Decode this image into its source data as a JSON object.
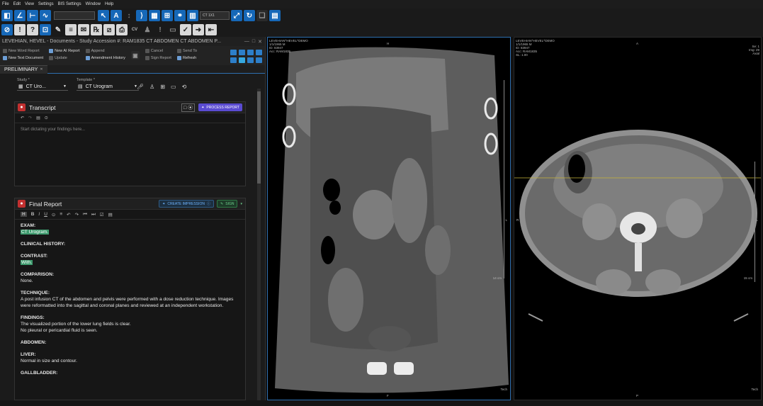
{
  "menu": [
    "File",
    "Edit",
    "View",
    "Settings",
    "BIS Settings",
    "Window",
    "Help"
  ],
  "toolbar": {
    "layout_combo": "CT 1X1"
  },
  "cv_label": "CV",
  "left": {
    "window_title": "LEVEHIAN, HEVEL - Documents - Study Accession #: RAM1835 CT ABDOMEN CT ABDOMEN P...",
    "doc_actions": {
      "new_word_report": "New Word Report",
      "new_text_document": "New Text Document",
      "new_ai_report": "New AI Report",
      "update": "Update",
      "append": "Append",
      "amendment_history": "Amendment History",
      "cancel": "Cancel",
      "sign_report": "Sign Report",
      "send_to": "Send To",
      "refresh": "Refresh"
    },
    "tab": "PRELIMINARY",
    "study_label": "Study *",
    "study_value": "CT Uro...",
    "template_label": "Template *",
    "template_value": "CT Urogram",
    "transcript": {
      "title": "Transcript",
      "process_label": "PROCESS REPORT",
      "placeholder": "Start dictating your findings here..."
    },
    "final_report": {
      "title": "Final Report",
      "create_impression": "CREATE IMPRESSION",
      "sign": "SIGN",
      "exam_h": "EXAM:",
      "exam_v": "CT Urogram.",
      "history_h": "CLINICAL HISTORY:",
      "contrast_h": "CONTRAST:",
      "contrast_v": "With.",
      "comparison_h": "COMPARISON:",
      "comparison_v": "None.",
      "technique_h": "TECHNIQUE:",
      "technique_v": "A post infusion CT of the abdomen and pelvis were performed with a dose reduction technique.  Images were reformatted into the sagittal and coronal planes and reviewed at an independent workstation.",
      "findings_h": "FINDINGS:",
      "findings_v1": "The visualized portion of the lower lung fields is clear.",
      "findings_v2": "No pleural or pericardial fluid is seen.",
      "abdomen_h": "ABDOMEN:",
      "liver_h": "LIVER:",
      "liver_v": "Normal in size and contour.",
      "gallbladder_h": "GALLBLADDER:"
    }
  },
  "viewer1": {
    "patient": "LEVEHIAN^HEVEL^DEMO",
    "dob": "1/1/1965 M",
    "id": "ID: 83947",
    "acc": "Acc: RAM1835",
    "orient_top": "H",
    "orient_right": "L",
    "scale": "14 cm",
    "tech": "Tech",
    "orient_bottom": "F"
  },
  "viewer2": {
    "patient": "LEVEHIAN^HEVEL^DEMO",
    "dob": "1/1/1965 M",
    "id": "ID: 83947",
    "acc": "Acc: RAM1835",
    "sl": "SL: 1.00",
    "orient_top": "A",
    "orient_left": "R",
    "orient_right": "L",
    "se": "Se: 1",
    "img": "Img: 29",
    "axial": "Axial",
    "scale": "15 cm",
    "tech": "Tech",
    "orient_bottom": "P"
  }
}
